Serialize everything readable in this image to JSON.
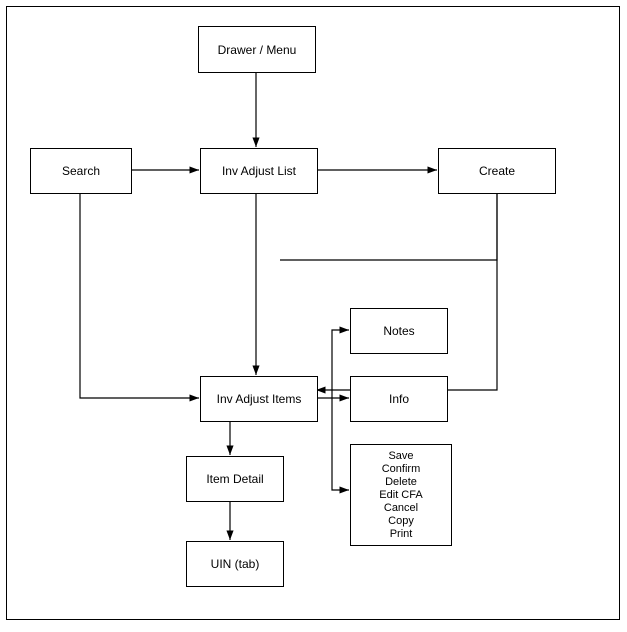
{
  "nodes": {
    "drawer": "Drawer / Menu",
    "search": "Search",
    "invList": "Inv Adjust List",
    "create": "Create",
    "invItems": "Inv Adjust Items",
    "notes": "Notes",
    "info": "Info",
    "itemDetail": "Item Detail",
    "uinTab": "UIN (tab)"
  },
  "actions": [
    "Save",
    "Confirm",
    "Delete",
    "Edit CFA",
    "Cancel",
    "Copy",
    "Print"
  ]
}
